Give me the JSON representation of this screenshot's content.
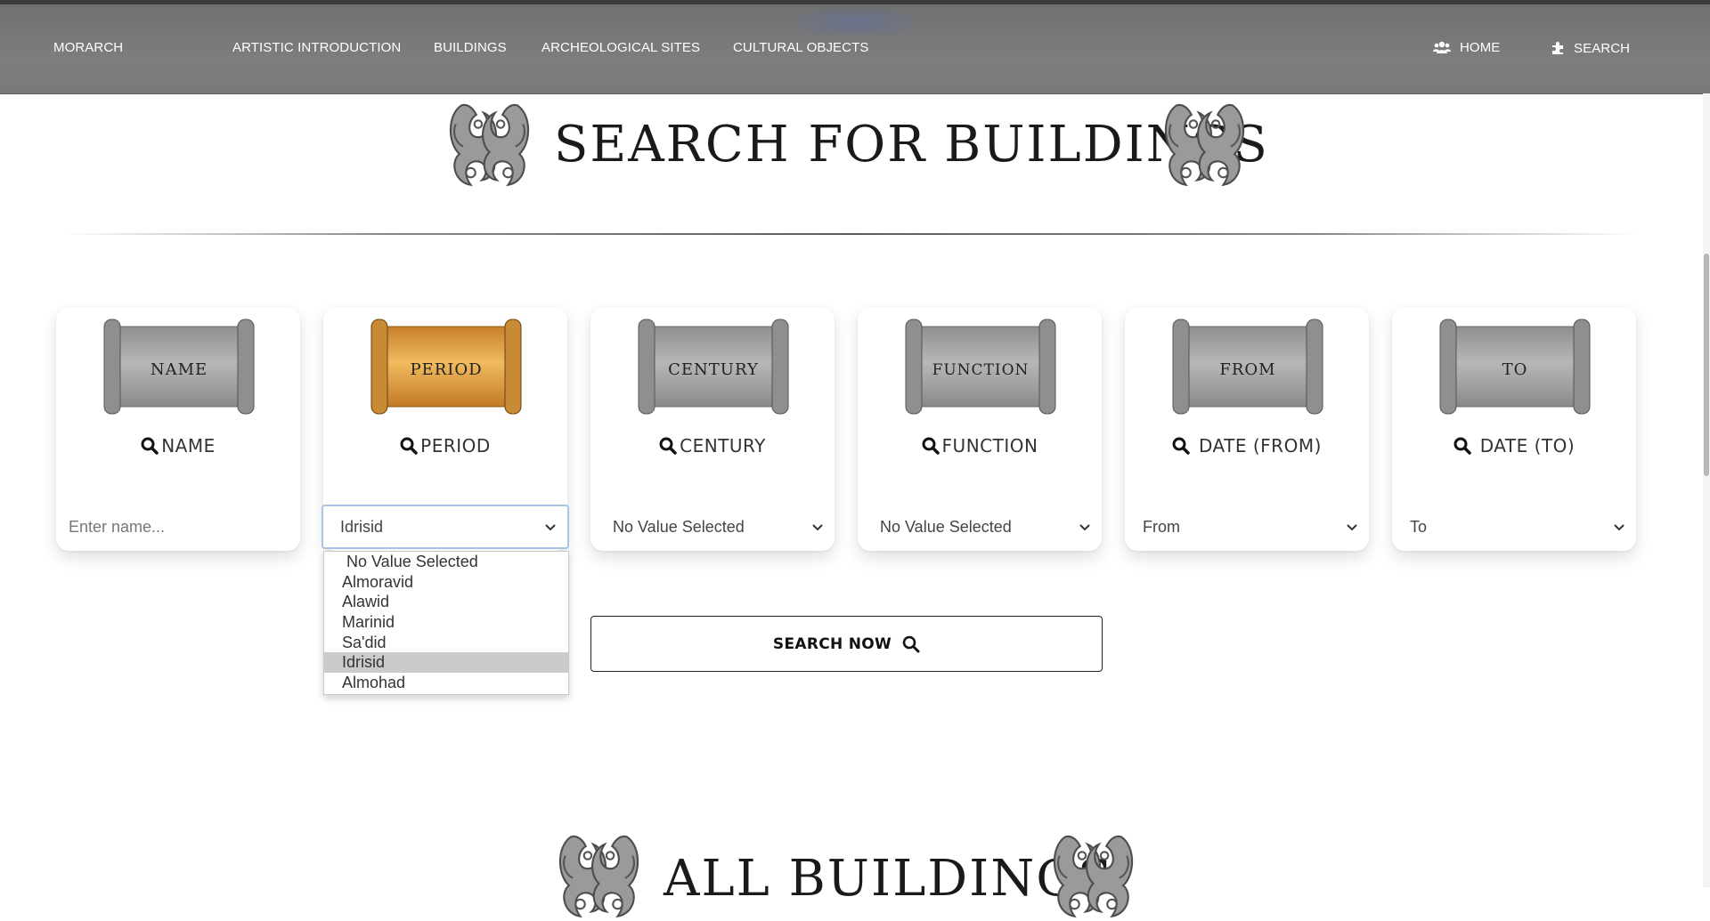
{
  "nav": {
    "brand": "MORARCH",
    "links": [
      "ARTISTIC INTRODUCTION",
      "BUILDINGS",
      "ARCHEOLOGICAL SITES",
      "CULTURAL OBJECTS"
    ],
    "home_label": "HOME",
    "home_icon": "users-icon",
    "search_label": "SEARCH",
    "search_icon": "puzzle-icon"
  },
  "page": {
    "title": "SEARCH FOR BUILDINGS",
    "section_title": "ALL BUILDINGS"
  },
  "cards": [
    {
      "scroll_text": "NAME",
      "label": "NAME",
      "type": "input",
      "placeholder": "Enter name...",
      "scroll_color": "gray"
    },
    {
      "scroll_text": "PERIOD",
      "label": "PERIOD",
      "type": "select",
      "value": "Idrisid",
      "scroll_color": "gold"
    },
    {
      "scroll_text": "CENTURY",
      "label": "CENTURY",
      "type": "select",
      "value": "No Value Selected",
      "scroll_color": "gray"
    },
    {
      "scroll_text": "FUNCTION",
      "label": "FUNCTION",
      "type": "select",
      "value": "No Value Selected",
      "scroll_color": "gray"
    },
    {
      "scroll_text": "FROM",
      "label": " DATE (FROM)",
      "type": "select",
      "value": "From",
      "scroll_color": "gray"
    },
    {
      "scroll_text": "TO",
      "label": " DATE (TO)",
      "type": "select",
      "value": "To",
      "scroll_color": "gray"
    }
  ],
  "period_dropdown": {
    "options": [
      "No Value Selected",
      "Almoravid",
      "Alawid",
      "Marinid",
      "Sa'did",
      "Idrisid",
      "Almohad"
    ],
    "selected": "Idrisid"
  },
  "search_button": {
    "label": "SEARCH NOW",
    "icon": "search-icon"
  },
  "colors": {
    "navbar": "#7a7a7a",
    "scroll_gray": "#a9a9a9",
    "scroll_gold": "#d99a3a",
    "active_border": "#a7c4e6",
    "selected_option": "#cbcbcb"
  }
}
